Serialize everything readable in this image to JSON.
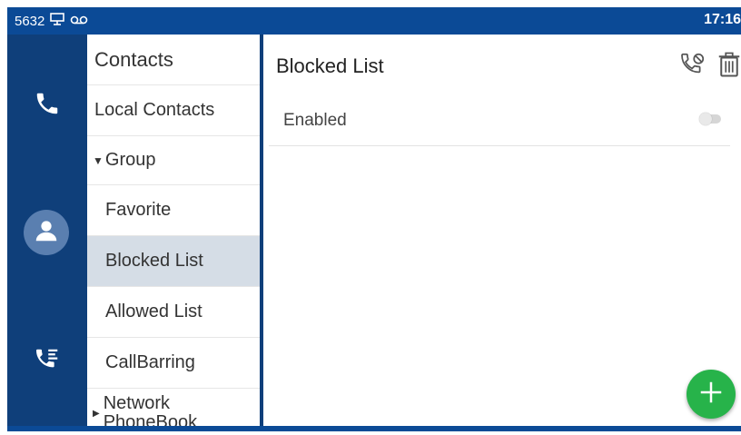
{
  "status": {
    "extension": "5632",
    "time": "17:16"
  },
  "menu": {
    "header": "Contacts",
    "items": [
      {
        "label": "Local Contacts"
      },
      {
        "label": "Group"
      },
      {
        "label": "Favorite"
      },
      {
        "label": "Blocked List"
      },
      {
        "label": "Allowed List"
      },
      {
        "label": "CallBarring"
      },
      {
        "label": "Network PhoneBook"
      }
    ]
  },
  "content": {
    "title": "Blocked List",
    "enabled_label": "Enabled",
    "enabled": false
  },
  "colors": {
    "status_bar": "#0b4a96",
    "rail": "#0f3f7a",
    "selected_item": "#d5dde6",
    "fab": "#27b34a"
  },
  "icons": {
    "rail": [
      "phone-icon",
      "contacts-icon",
      "call-history-icon"
    ],
    "actions": [
      "blocked-call-icon",
      "delete-icon"
    ],
    "fab": "add-icon"
  }
}
